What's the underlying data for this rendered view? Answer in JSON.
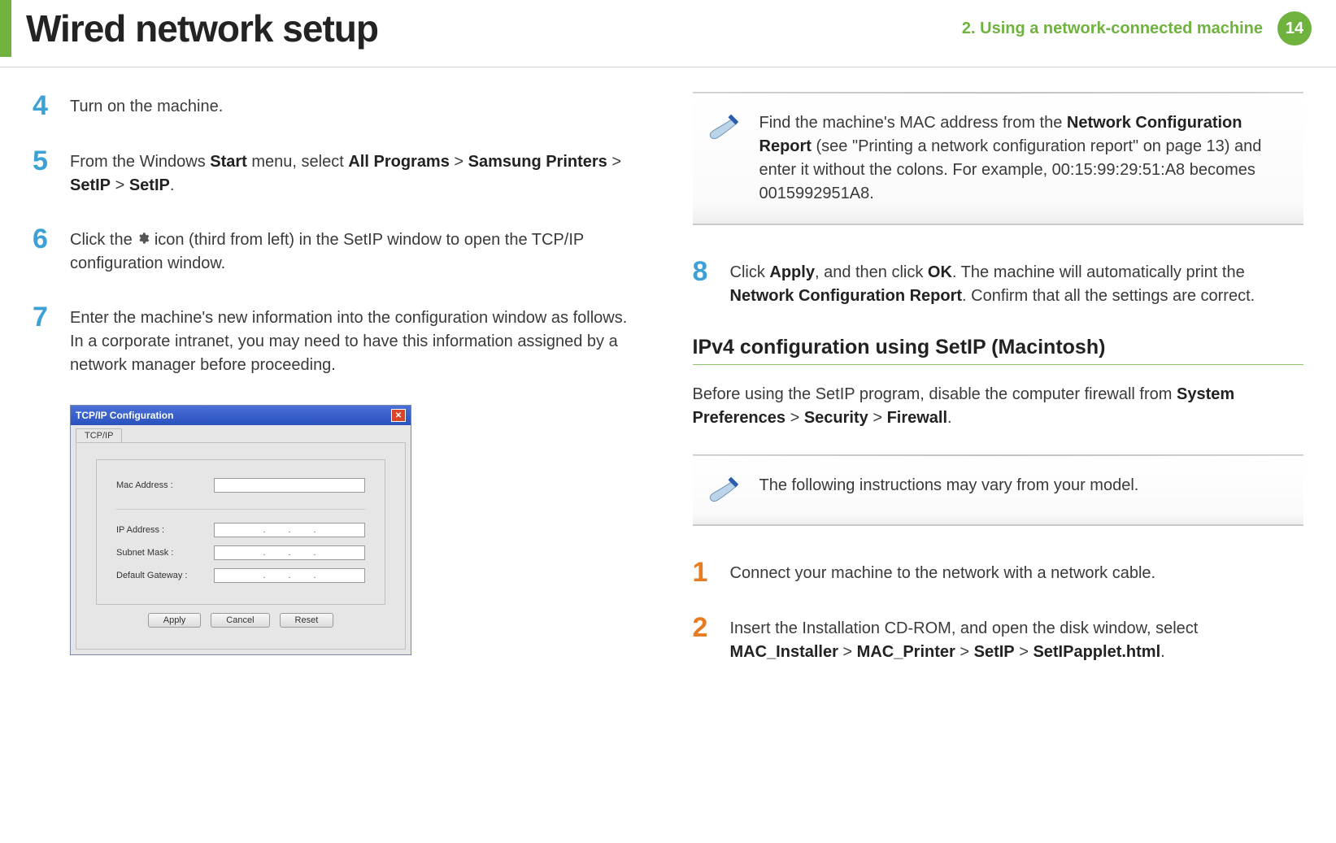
{
  "header": {
    "title": "Wired network setup",
    "chapter": "2.  Using a network-connected machine",
    "page_number": "14"
  },
  "left_steps": [
    {
      "num": "4",
      "text_plain": "Turn on the machine."
    },
    {
      "num": "5",
      "text_pre": "From the Windows ",
      "bolds": [
        "Start",
        "All Programs",
        "Samsung Printers",
        "SetIP",
        "SetIP"
      ],
      "joins": [
        " menu, select ",
        " > ",
        " > ",
        " > ",
        "."
      ]
    },
    {
      "num": "6",
      "text_pre": "Click the ",
      "icon": "gear",
      "text_post": " icon (third from left) in the SetIP window to open the TCP/IP configuration window."
    },
    {
      "num": "7",
      "text_plain": "Enter the machine's new information into the configuration window as follows. In a corporate intranet, you may need to have this information assigned by a network manager before proceeding."
    }
  ],
  "tcpip": {
    "title": "TCP/IP Configuration",
    "tab": "TCP/IP",
    "fields": {
      "mac": "Mac Address :",
      "ip": "IP Address :",
      "subnet": "Subnet Mask :",
      "gateway": "Default Gateway :"
    },
    "buttons": {
      "apply": "Apply",
      "cancel": "Cancel",
      "reset": "Reset"
    }
  },
  "note1": {
    "text_pre": "Find the machine's MAC address from the ",
    "bold1": "Network Configuration Report",
    "text_mid": " (see \"Printing a network configuration report\" on page 13) and enter it without the colons. For example, 00:15:99:29:51:A8 becomes 0015992951A8."
  },
  "step8": {
    "num": "8",
    "pre": "Click ",
    "b1": "Apply",
    "mid1": ", and then click ",
    "b2": "OK",
    "mid2": ". The machine will automatically print the ",
    "b3": "Network Configuration Report",
    "post": ". Confirm that all the settings are correct."
  },
  "subhead": "IPv4 configuration using SetIP (Macintosh)",
  "mac_para": {
    "pre": "Before using the SetIP program, disable the computer firewall from ",
    "b1": "System Preferences",
    "sep": " > ",
    "b2": "Security",
    "b3": "Firewall",
    "post": "."
  },
  "note2": {
    "text": "The following instructions may vary from your model."
  },
  "mac_steps": [
    {
      "num": "1",
      "text_plain": "Connect your machine to the network with a network cable."
    },
    {
      "num": "2",
      "pre": "Insert the Installation CD-ROM, and open the disk window, select ",
      "b1": "MAC_Installer",
      "sep": " > ",
      "b2": "MAC_Printer",
      "b3": "SetIP",
      "b4": "SetIPapplet.html",
      "post": "."
    }
  ]
}
